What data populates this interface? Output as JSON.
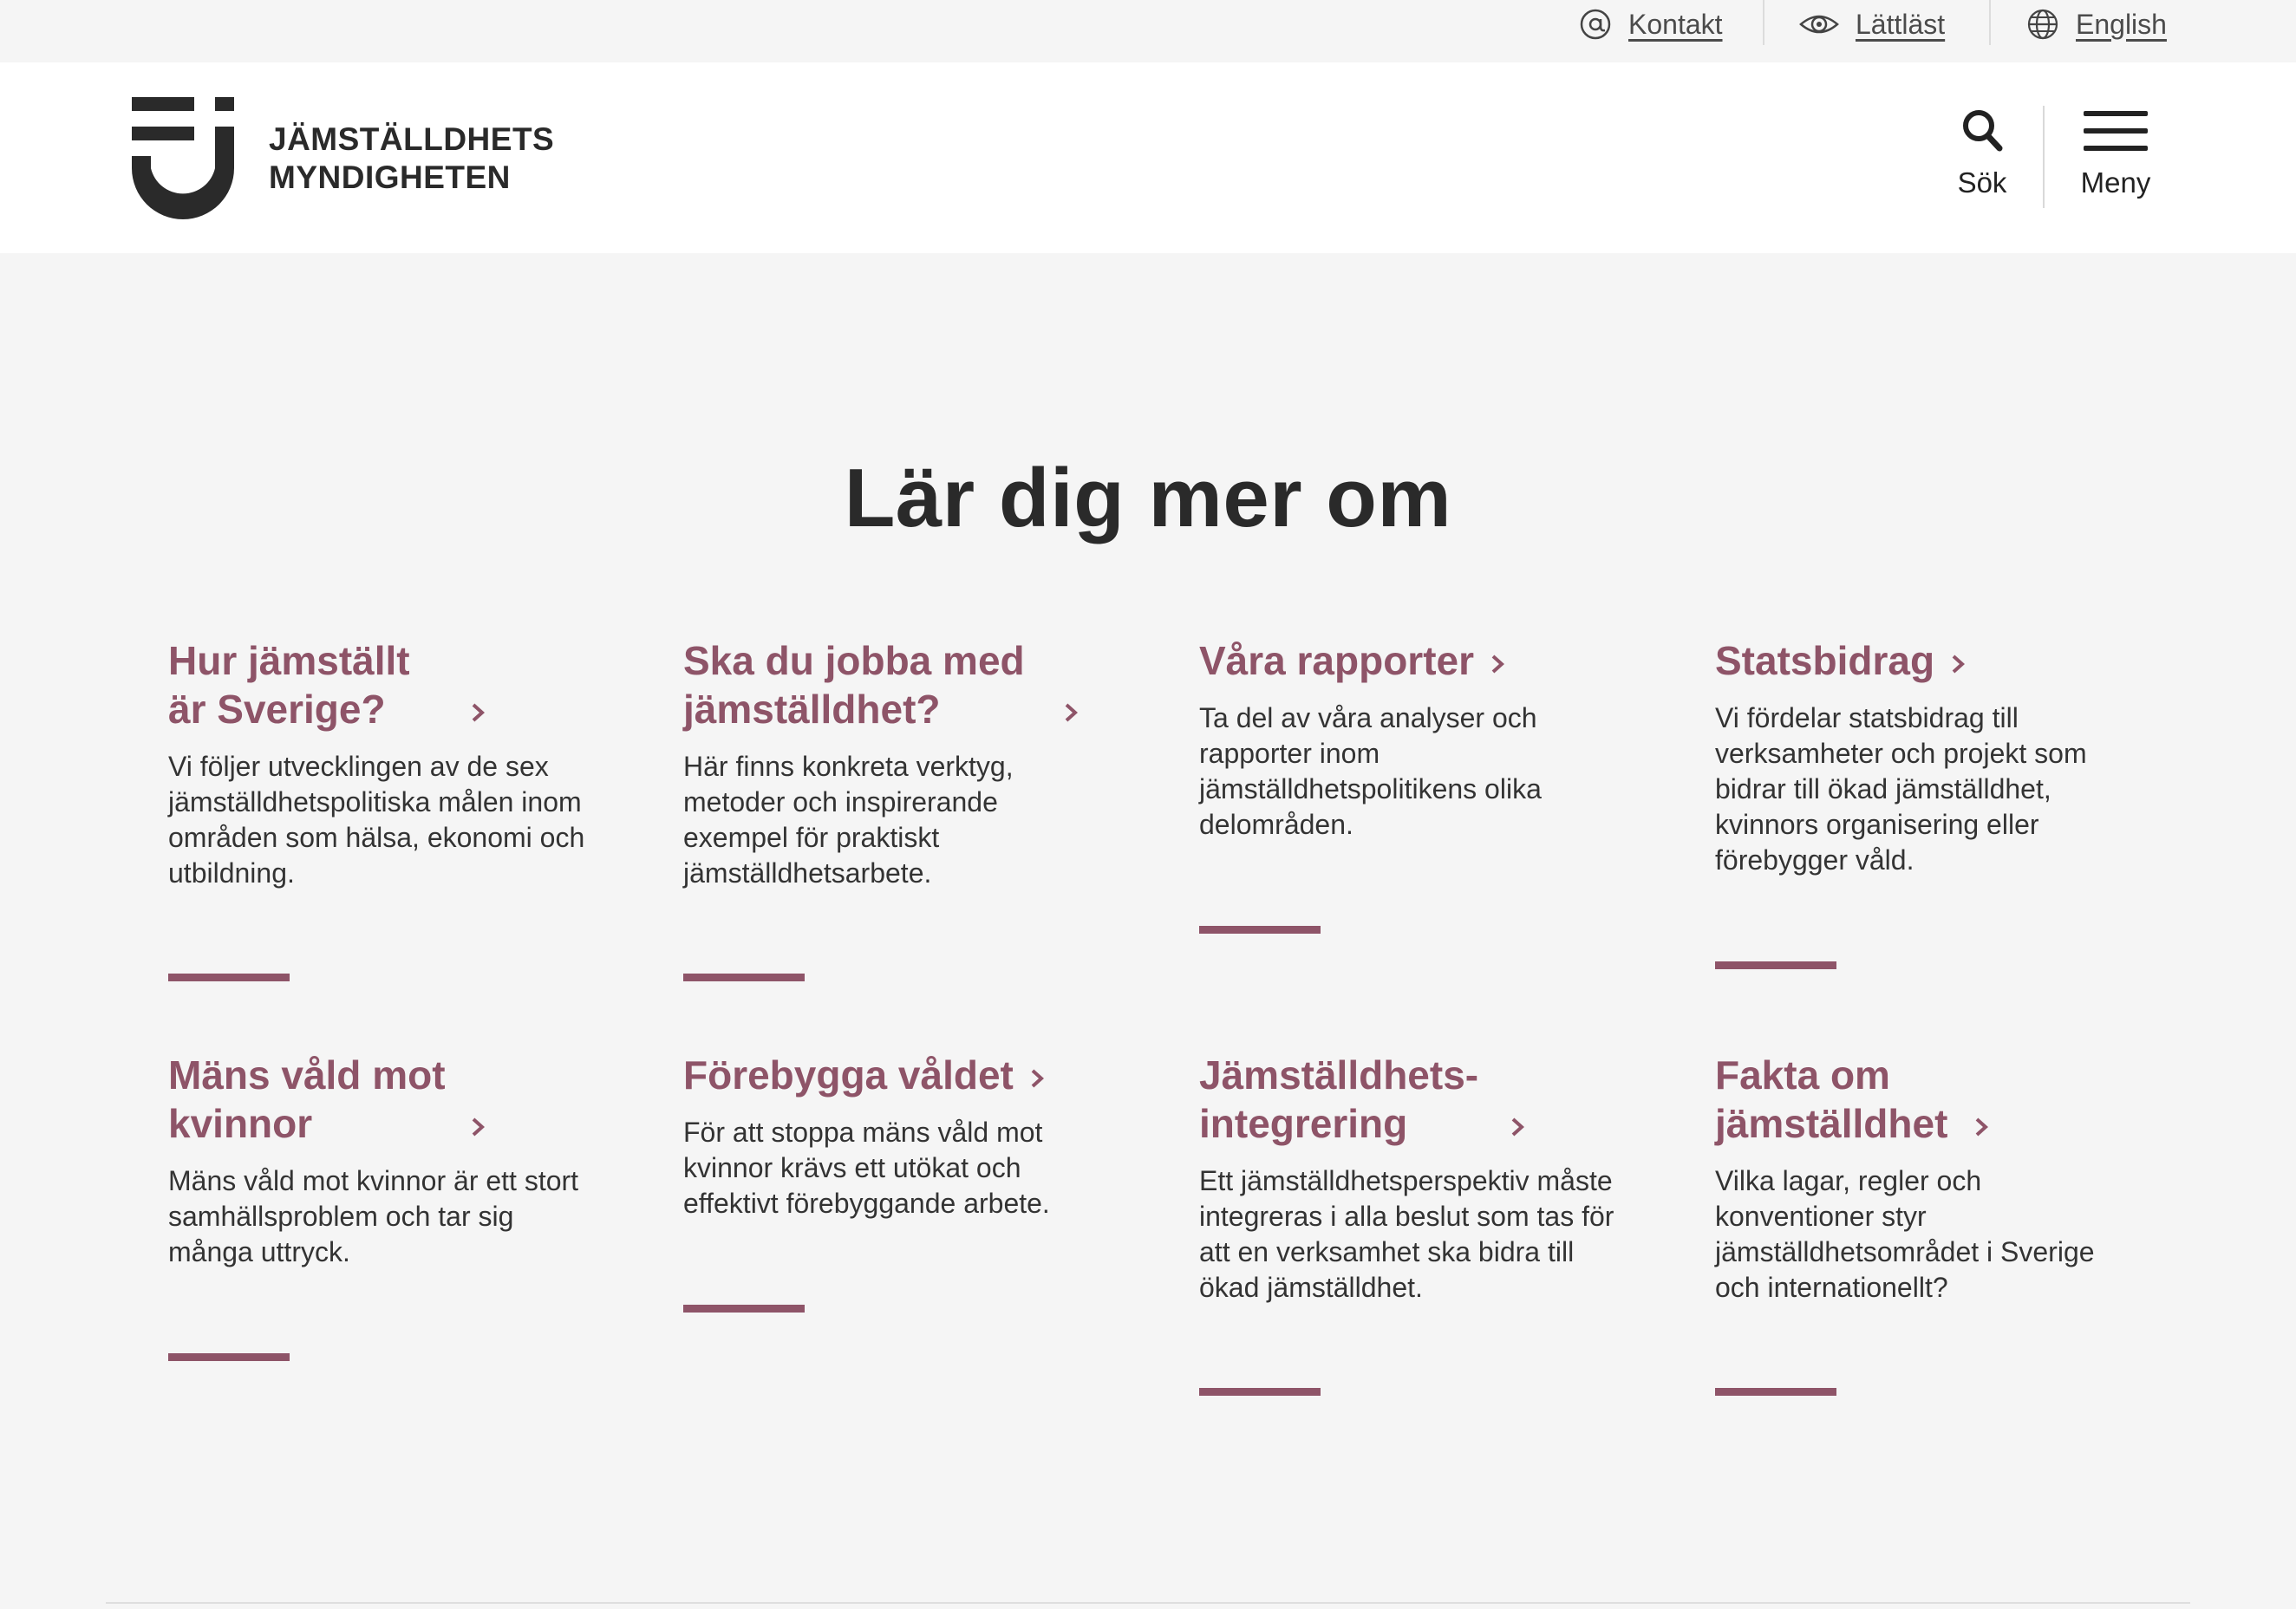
{
  "utility": {
    "contact": "Kontakt",
    "easy_read": "Lättläst",
    "english": "English"
  },
  "header": {
    "logo_line1": "JÄMSTÄLLDHETS",
    "logo_line2": "MYNDIGHETEN",
    "search_label": "Sök",
    "menu_label": "Meny"
  },
  "main": {
    "title": "Lär dig mer om",
    "cards": [
      {
        "title": "Hur jämställt är Sverige?",
        "desc": "Vi följer utvecklingen av de sex jämställdhetspolitiska målen inom områden som hälsa, ekonomi och utbildning."
      },
      {
        "title": "Ska du jobba med jämställdhet?",
        "desc": "Här finns konkreta verktyg, metoder och inspirerande exempel för praktiskt jämställdhetsarbete."
      },
      {
        "title": "Våra rapporter",
        "desc": "Ta del av våra analyser och rapporter inom jämställdhetspolitikens olika delområden."
      },
      {
        "title": "Statsbidrag",
        "desc": "Vi fördelar statsbidrag till verksamheter och projekt som bidrar till ökad jämställdhet, kvinnors organisering eller förebygger våld."
      },
      {
        "title": "Mäns våld mot kvinnor",
        "desc": "Mäns våld mot kvinnor är ett stort samhällsproblem och tar sig många uttryck."
      },
      {
        "title": "Förebygga våldet",
        "desc": "För att stoppa mäns våld mot kvinnor krävs ett utökat och effektivt förebyggande arbete."
      },
      {
        "title": "Jämställdhets-integrering",
        "desc": "Ett jämställdhetsperspektiv måste integreras i alla beslut som tas för att en verksamhet ska bidra till ökad jämställdhet."
      },
      {
        "title": "Fakta om jämställdhet",
        "desc": "Vilka lagar, regler och konventioner styr jämställdhetsområdet i Sverige och internationellt?"
      }
    ]
  },
  "colors": {
    "accent": "#8e5468",
    "text": "#222222",
    "background": "#f5f5f5",
    "header_bg": "#ffffff"
  }
}
